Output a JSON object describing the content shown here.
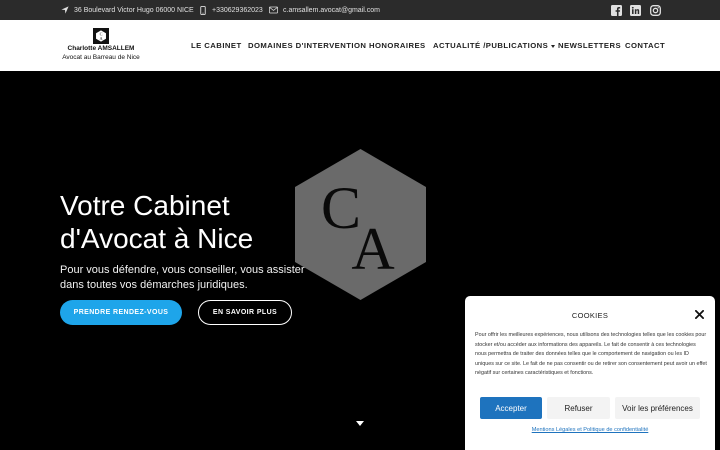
{
  "topbar": {
    "address": "36 Boulevard Victor Hugo 06000 NICE",
    "phone": "+330629362023",
    "email": "c.amsallem.avocat@gmail.com",
    "social_icons": [
      "facebook-icon",
      "linkedin-icon",
      "instagram-icon"
    ]
  },
  "brand": {
    "name": "Charlotte AMSALLEM",
    "subtitle": "Avocat au Barreau de Nice"
  },
  "nav": {
    "items": [
      {
        "label": "LE CABINET"
      },
      {
        "label": "DOMAINES D'INTERVENTION"
      },
      {
        "label": "HONORAIRES"
      },
      {
        "label": "ACTUALITÉ /PUBLICATIONS",
        "has_dropdown": true
      },
      {
        "label": "NEWSLETTERS"
      },
      {
        "label": "CONTACT"
      }
    ]
  },
  "hero": {
    "title_line1": "Votre Cabinet",
    "title_line2": "d'Avocat à Nice",
    "subtitle": "Pour vous défendre, vous conseiller, vous assister dans toutes vos démarches juridiques.",
    "primary_button": "PRENDRE RENDEZ-VOUS",
    "secondary_button": "EN SAVOIR PLUS",
    "logo_letters": {
      "top": "C",
      "bottom": "A"
    }
  },
  "cookie_banner": {
    "title": "COOKIES",
    "text": "Pour offrir les meilleures expériences, nous utilisons des technologies telles que les cookies pour stocker et/ou accéder aux informations des appareils. Le fait de consentir à ces technologies nous permettra de traiter des données telles que le comportement de navigation ou les ID uniques sur ce site. Le fait de ne pas consentir ou de retirer son consentement peut avoir un effet négatif sur certaines caractéristiques et fonctions.",
    "accept_label": "Accepter",
    "refuse_label": "Refuser",
    "prefs_label": "Voir les préférences",
    "legal_link": "Mentions Légales et Politique de confidentialité"
  },
  "colors": {
    "topbar_bg": "#2b2b2b",
    "primary_button": "#1ea5ea",
    "accept_button": "#1e73be",
    "hero_bg": "#000000"
  }
}
